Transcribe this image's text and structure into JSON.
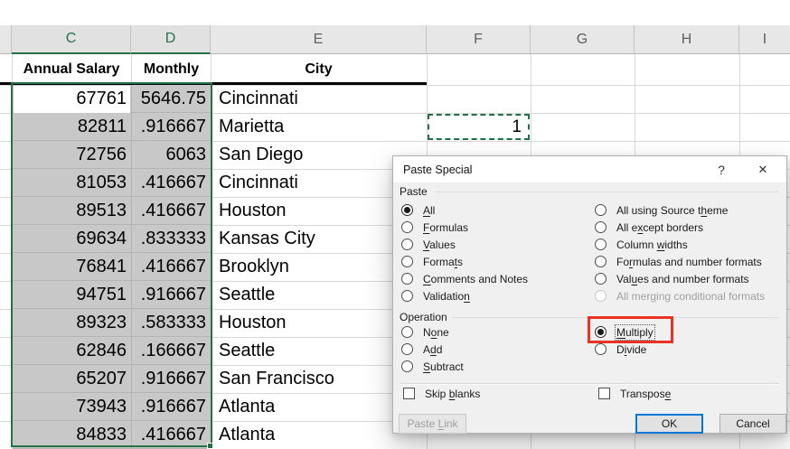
{
  "sheet": {
    "columns": [
      {
        "letter": ""
      },
      {
        "letter": "C",
        "selected": true
      },
      {
        "letter": "D",
        "selected": true
      },
      {
        "letter": "E"
      },
      {
        "letter": "F"
      },
      {
        "letter": "G"
      },
      {
        "letter": "H"
      },
      {
        "letter": "I"
      }
    ],
    "field_headers": [
      "Annual Salary",
      "Monthly",
      "City"
    ],
    "rows": [
      {
        "annual": "67761",
        "monthly": "5646.75",
        "city": "Cincinnati"
      },
      {
        "annual": "82811",
        "monthly": ".916667",
        "city": "Marietta"
      },
      {
        "annual": "72756",
        "monthly": "6063",
        "city": "San Diego"
      },
      {
        "annual": "81053",
        "monthly": ".416667",
        "city": "Cincinnati"
      },
      {
        "annual": "89513",
        "monthly": ".416667",
        "city": "Houston"
      },
      {
        "annual": "69634",
        "monthly": ".833333",
        "city": "Kansas City"
      },
      {
        "annual": "76841",
        "monthly": ".416667",
        "city": "Brooklyn"
      },
      {
        "annual": "94751",
        "monthly": ".916667",
        "city": "Seattle"
      },
      {
        "annual": "89323",
        "monthly": ".583333",
        "city": "Houston"
      },
      {
        "annual": "62846",
        "monthly": ".166667",
        "city": "Seattle"
      },
      {
        "annual": "65207",
        "monthly": ".916667",
        "city": "San Francisco"
      },
      {
        "annual": "73943",
        "monthly": ".916667",
        "city": "Atlanta"
      },
      {
        "annual": "84833",
        "monthly": ".416667",
        "city": "Atlanta"
      }
    ],
    "copied_cell": {
      "value": "1"
    }
  },
  "dialog": {
    "title": "Paste Special",
    "help_icon": "?",
    "close_icon": "✕",
    "paste": {
      "label": "Paste",
      "left": [
        {
          "label": "All",
          "accel": 0,
          "state": "selected"
        },
        {
          "label": "Formulas",
          "accel": 0
        },
        {
          "label": "Values",
          "accel": 0
        },
        {
          "label": "Formats",
          "accel": 5
        },
        {
          "label": "Comments and Notes",
          "accel": 0
        },
        {
          "label": "Validation",
          "accel": 9
        }
      ],
      "right": [
        {
          "label": "All using Source theme",
          "accel": 18
        },
        {
          "label": "All except borders",
          "accel": 5
        },
        {
          "label": "Column widths",
          "accel": 7
        },
        {
          "label": "Formulas and number formats",
          "accel": 2
        },
        {
          "label": "Values and number formats",
          "accel": 3
        },
        {
          "label": "All merging conditional formats",
          "accel": 7,
          "state": "disabled"
        }
      ]
    },
    "operation": {
      "label": "Operation",
      "left": [
        {
          "label": "None",
          "accel": 1
        },
        {
          "label": "Add",
          "accel": 1
        },
        {
          "label": "Subtract",
          "accel": 0
        }
      ],
      "right": [
        {
          "label": "Multiply",
          "accel": 0,
          "state": "selected",
          "focused": true,
          "highlighted": true
        },
        {
          "label": "Divide",
          "accel": 1
        }
      ]
    },
    "checkboxes": [
      {
        "label": "Skip blanks",
        "accel": 5
      },
      {
        "label": "Transpose",
        "accel": 8
      }
    ],
    "buttons": [
      {
        "label": "Paste Link",
        "accel": 6,
        "state": "disabled"
      },
      {
        "label": "OK",
        "state": "default"
      },
      {
        "label": "Cancel"
      }
    ],
    "colors": {
      "highlight_red": "#ea3123",
      "focus_blue": "#0078d7"
    }
  },
  "colors": {
    "excel_green": "#217346",
    "selection_gray": "#c8c8c8"
  }
}
